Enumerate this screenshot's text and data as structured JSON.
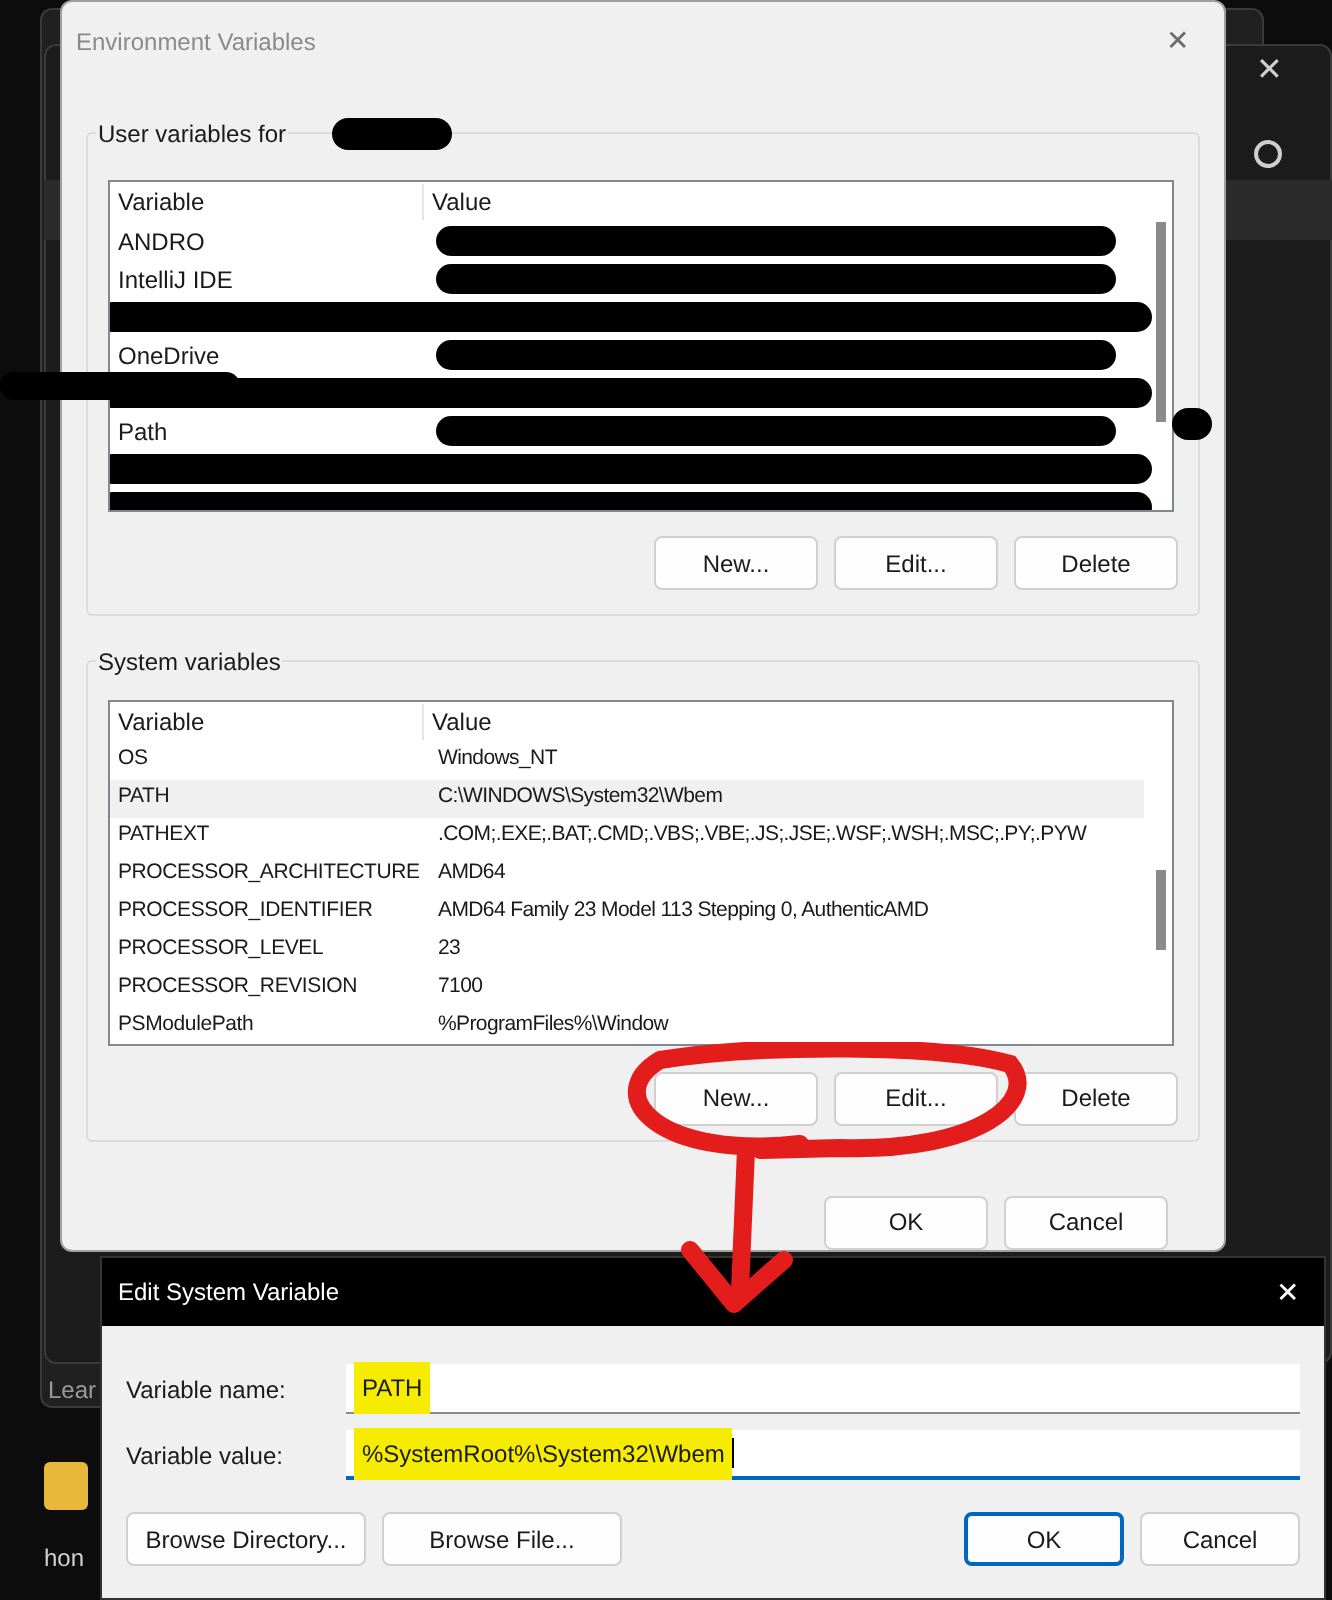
{
  "background": {
    "fragments": [
      "Lear",
      "hon"
    ]
  },
  "window": {
    "title": "Environment Variables"
  },
  "user_variables": {
    "label": "User variables for",
    "columns": [
      "Variable",
      "Value"
    ],
    "rows": [
      {
        "variable": "ANDRO",
        "redacted": false
      },
      {
        "variable": "IntelliJ IDE",
        "redacted": false
      },
      {
        "variable": "",
        "redacted": true
      },
      {
        "variable": "OneDrive",
        "redacted": false
      },
      {
        "variable": "",
        "redacted": true
      },
      {
        "variable": "Path",
        "redacted": false
      },
      {
        "variable": "",
        "redacted": true
      },
      {
        "variable": "",
        "redacted": true
      }
    ],
    "buttons": [
      "New...",
      "Edit...",
      "Delete"
    ]
  },
  "system_variables": {
    "label": "System variables",
    "columns": [
      "Variable",
      "Value"
    ],
    "rows": [
      {
        "variable": "OS",
        "value": "Windows_NT",
        "selected": false
      },
      {
        "variable": "PATH",
        "value": "C:\\WINDOWS\\System32\\Wbem",
        "selected": true
      },
      {
        "variable": "PATHEXT",
        "value": ".COM;.EXE;.BAT;.CMD;.VBS;.VBE;.JS;.JSE;.WSF;.WSH;.MSC;.PY;.PYW",
        "selected": false
      },
      {
        "variable": "PROCESSOR_ARCHITECTURE",
        "value": "AMD64",
        "selected": false
      },
      {
        "variable": "PROCESSOR_IDENTIFIER",
        "value": "AMD64 Family 23 Model 113 Stepping 0, AuthenticAMD",
        "selected": false
      },
      {
        "variable": "PROCESSOR_LEVEL",
        "value": "23",
        "selected": false
      },
      {
        "variable": "PROCESSOR_REVISION",
        "value": "7100",
        "selected": false
      },
      {
        "variable": "PSModulePath",
        "value": "%ProgramFiles%\\Window",
        "selected": false
      }
    ],
    "buttons": [
      "New...",
      "Edit...",
      "Delete"
    ]
  },
  "dialog_buttons": [
    "OK",
    "Cancel"
  ],
  "edit_dialog": {
    "title": "Edit System Variable",
    "close": "✕",
    "fields": [
      {
        "label": "Variable name:",
        "value": "PATH",
        "focused": false
      },
      {
        "label": "Variable value:",
        "value": "%SystemRoot%\\System32\\Wbem",
        "focused": true
      }
    ],
    "buttons": [
      {
        "label": "Browse Directory...",
        "default": false
      },
      {
        "label": "Browse File...",
        "default": false
      },
      {
        "label": "OK",
        "default": true
      },
      {
        "label": "Cancel",
        "default": false
      }
    ]
  },
  "close": "✕"
}
